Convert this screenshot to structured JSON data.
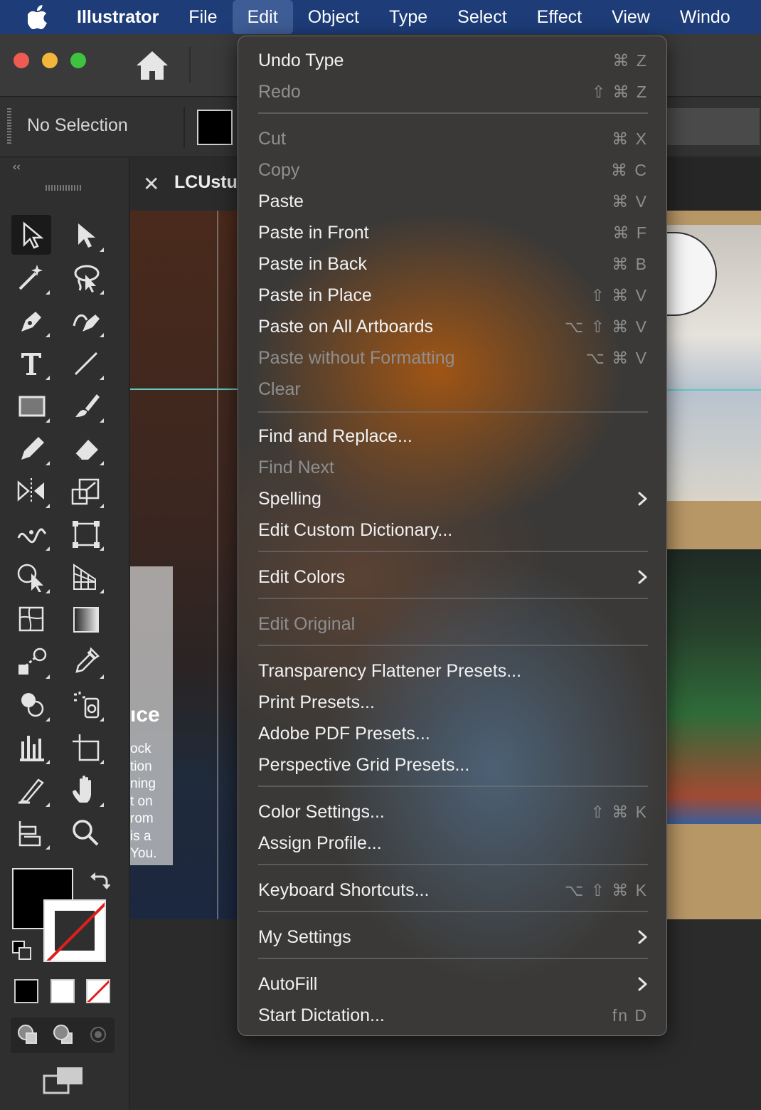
{
  "menubar": {
    "app": "Illustrator",
    "items": [
      "File",
      "Edit",
      "Object",
      "Type",
      "Select",
      "Effect",
      "View",
      "Windo"
    ]
  },
  "control_bar": {
    "selection_status": "No Selection"
  },
  "document": {
    "tab_name": "LCUstu"
  },
  "canvas_text": {
    "heading": "ıce",
    "lines": [
      "ock",
      "tion",
      "ning",
      "t on",
      "rom",
      "is a",
      "You."
    ]
  },
  "edit_menu": {
    "items": [
      {
        "label": "Undo Type",
        "shortcut": "⌘ Z",
        "enabled": true
      },
      {
        "label": "Redo",
        "shortcut": "⇧ ⌘ Z",
        "enabled": false
      },
      {
        "label": "Cut",
        "shortcut": "⌘ X",
        "enabled": false
      },
      {
        "label": "Copy",
        "shortcut": "⌘ C",
        "enabled": false
      },
      {
        "label": "Paste",
        "shortcut": "⌘ V",
        "enabled": true
      },
      {
        "label": "Paste in Front",
        "shortcut": "⌘ F",
        "enabled": true
      },
      {
        "label": "Paste in Back",
        "shortcut": "⌘ B",
        "enabled": true
      },
      {
        "label": "Paste in Place",
        "shortcut": "⇧ ⌘ V",
        "enabled": true
      },
      {
        "label": "Paste on All Artboards",
        "shortcut": "⌥ ⇧ ⌘ V",
        "enabled": true
      },
      {
        "label": "Paste without Formatting",
        "shortcut": "⌥ ⌘ V",
        "enabled": false
      },
      {
        "label": "Clear",
        "shortcut": "",
        "enabled": false
      },
      {
        "label": "Find and Replace...",
        "shortcut": "",
        "enabled": true
      },
      {
        "label": "Find Next",
        "shortcut": "",
        "enabled": false
      },
      {
        "label": "Spelling",
        "shortcut": "",
        "enabled": true,
        "submenu": true
      },
      {
        "label": "Edit Custom Dictionary...",
        "shortcut": "",
        "enabled": true
      },
      {
        "label": "Edit Colors",
        "shortcut": "",
        "enabled": true,
        "submenu": true
      },
      {
        "label": "Edit Original",
        "shortcut": "",
        "enabled": false
      },
      {
        "label": "Transparency Flattener Presets...",
        "shortcut": "",
        "enabled": true
      },
      {
        "label": "Print Presets...",
        "shortcut": "",
        "enabled": true
      },
      {
        "label": "Adobe PDF Presets...",
        "shortcut": "",
        "enabled": true
      },
      {
        "label": "Perspective Grid Presets...",
        "shortcut": "",
        "enabled": true
      },
      {
        "label": "Color Settings...",
        "shortcut": "⇧ ⌘ K",
        "enabled": true
      },
      {
        "label": "Assign Profile...",
        "shortcut": "",
        "enabled": true
      },
      {
        "label": "Keyboard Shortcuts...",
        "shortcut": "⌥ ⇧ ⌘ K",
        "enabled": true
      },
      {
        "label": "My Settings",
        "shortcut": "",
        "enabled": true,
        "submenu": true
      },
      {
        "label": "AutoFill",
        "shortcut": "",
        "enabled": true,
        "submenu": true
      },
      {
        "label": "Start Dictation...",
        "shortcut": "fn D",
        "enabled": true
      }
    ]
  },
  "tools": [
    "selection-tool",
    "direct-selection-tool",
    "magic-wand-tool",
    "lasso-tool",
    "pen-tool",
    "curvature-tool",
    "type-tool",
    "line-segment-tool",
    "rectangle-tool",
    "paintbrush-tool",
    "pencil-tool",
    "eraser-tool",
    "reflect-tool",
    "scale-tool",
    "width-tool",
    "free-transform-tool",
    "shape-builder-tool",
    "perspective-grid-tool",
    "mesh-tool",
    "gradient-tool",
    "blend-tool",
    "eyedropper-tool",
    "symbol-sprayer-tool",
    "live-paint-tool",
    "column-graph-tool",
    "artboard-tool",
    "slice-tool",
    "hand-tool",
    "puppet-warp-tool",
    "zoom-tool"
  ],
  "colors": {
    "menubar_bg": "#1d3c78",
    "fill": "#000000",
    "stroke_none_slash": "#e01e1e",
    "guide": "#5fc9c2"
  }
}
